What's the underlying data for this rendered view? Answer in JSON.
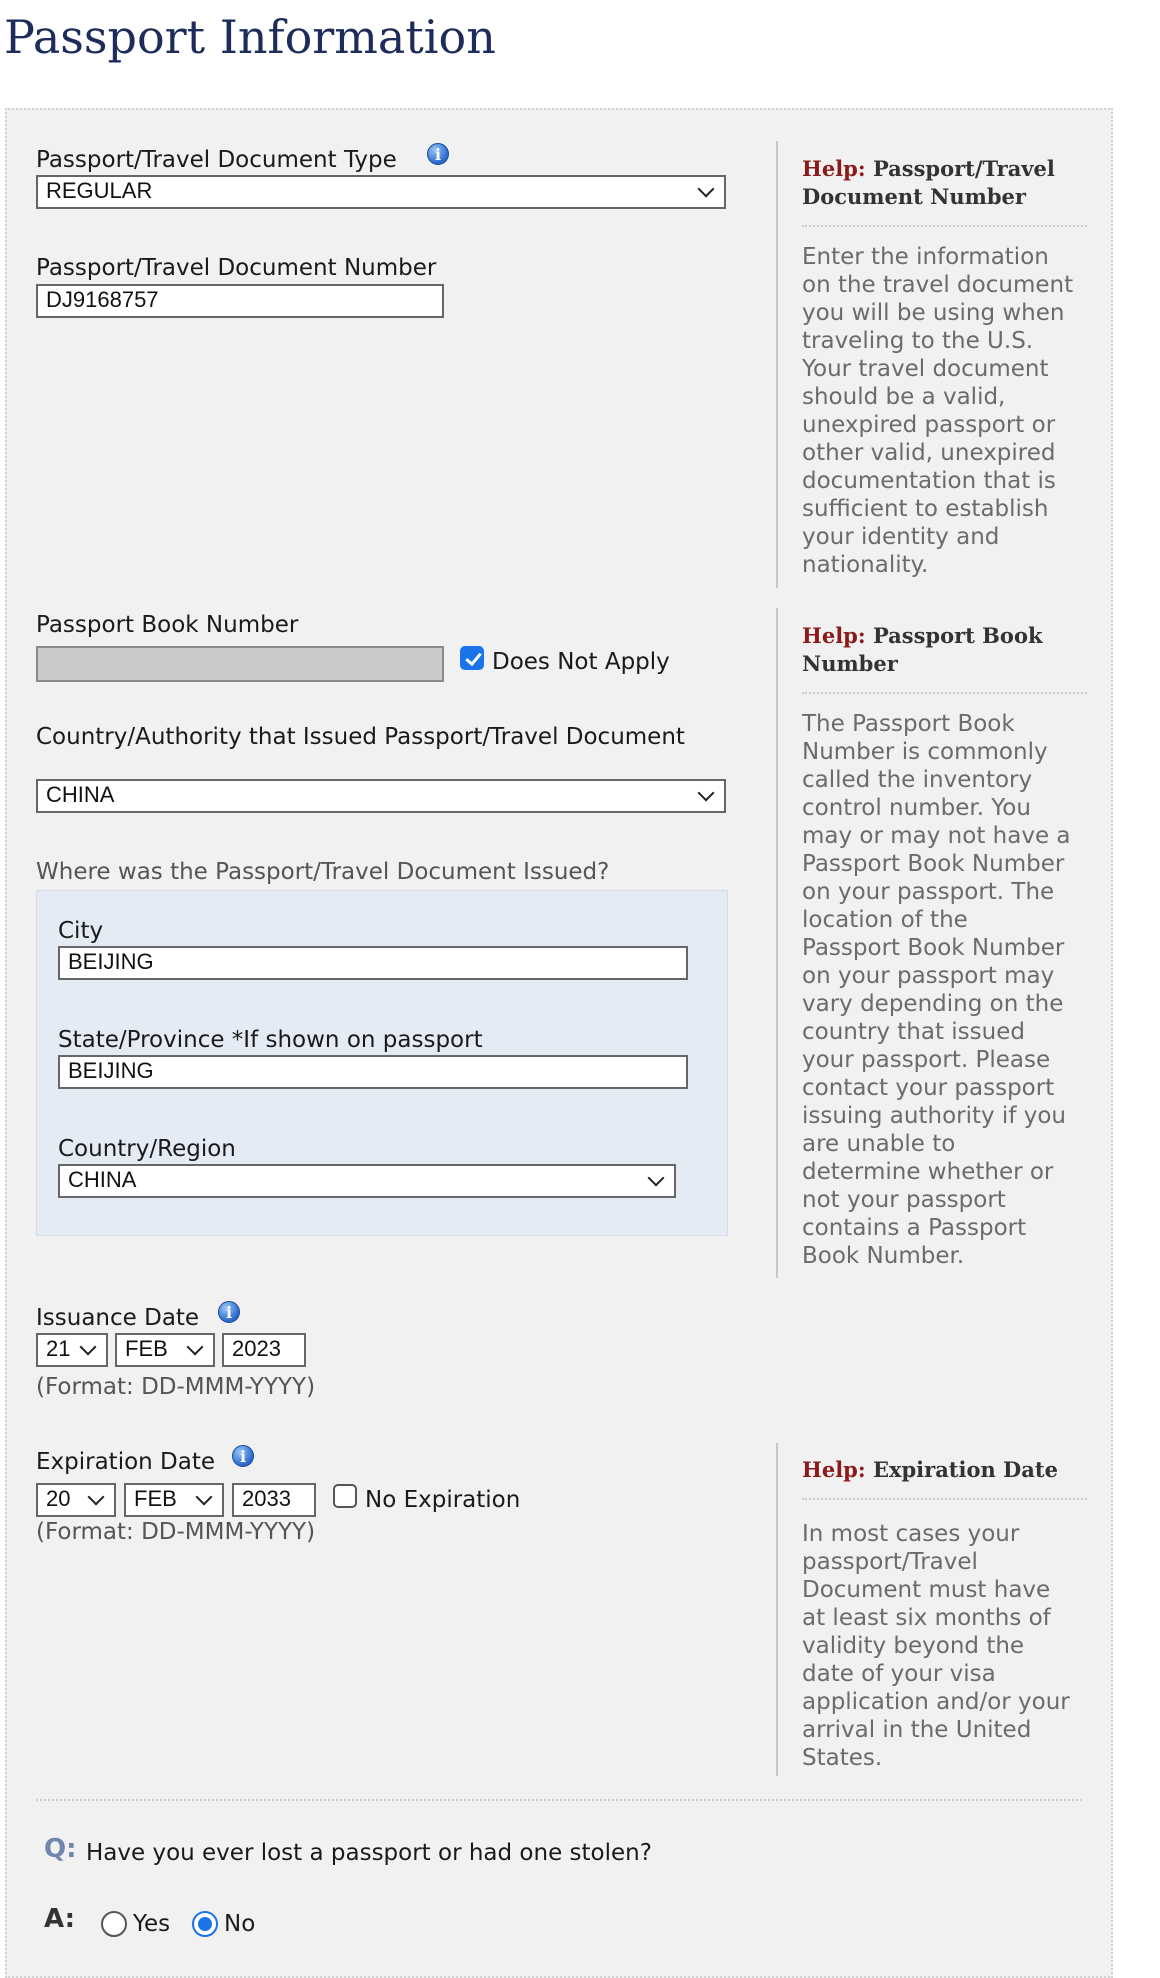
{
  "page_title": "Passport Information",
  "colors": {
    "title": "#1d2c5a",
    "help_word": "#8b1a1a",
    "accent": "#1a73e8",
    "issued_panel": "#e4ebf5"
  },
  "doc_type": {
    "label": "Passport/Travel Document Type",
    "value": "REGULAR",
    "info_icon": "info-icon"
  },
  "doc_number": {
    "label": "Passport/Travel Document Number",
    "value": "DJ9168757"
  },
  "book_number": {
    "label": "Passport Book Number",
    "value": "",
    "does_not_apply_label": "Does Not Apply",
    "does_not_apply_checked": true
  },
  "issuing_country": {
    "label": "Country/Authority that Issued Passport/Travel Document",
    "value": "CHINA"
  },
  "issued_where": {
    "label": "Where was the Passport/Travel Document Issued?",
    "city_label": "City",
    "city_value": "BEIJING",
    "state_label": "State/Province *If shown on passport",
    "state_value": "BEIJING",
    "country_label": "Country/Region",
    "country_value": "CHINA"
  },
  "issuance_date": {
    "label": "Issuance Date",
    "day": "21",
    "month": "FEB",
    "year": "2023",
    "format": "(Format: DD-MMM-YYYY)"
  },
  "expiration_date": {
    "label": "Expiration Date",
    "day": "20",
    "month": "FEB",
    "year": "2033",
    "no_expiration_label": "No Expiration",
    "no_expiration_checked": false,
    "format": "(Format: DD-MMM-YYYY)"
  },
  "help": [
    {
      "word": "Help:",
      "title": "Passport/Travel Document Number",
      "lines": [
        "Enter the information",
        "on the travel document",
        "you will be using when",
        "traveling to the U.S.",
        "Your travel document",
        "should be a valid,",
        "unexpired passport or",
        "other valid, unexpired",
        "documentation that is",
        "sufficient to establish",
        "your identity and",
        "nationality."
      ]
    },
    {
      "word": "Help:",
      "title": "Passport Book Number",
      "lines": [
        "The Passport Book",
        "Number is commonly",
        "called the inventory",
        "control number. You",
        "may or may not have a",
        "Passport Book Number",
        "on your passport. The",
        "location of the",
        "Passport Book Number",
        "on your passport may",
        "vary depending on the",
        "country that issued",
        "your passport. Please",
        "contact your passport",
        "issuing authority if you",
        "are unable to",
        "determine whether or",
        "not your passport",
        "contains a Passport",
        "Book Number."
      ]
    },
    {
      "word": "Help:",
      "title": "Expiration Date",
      "lines": [
        "In most cases your",
        "passport/Travel",
        "Document must have",
        "at least six months of",
        "validity beyond the",
        "date of your visa",
        "application and/or your",
        "arrival in the United",
        "States."
      ]
    }
  ],
  "lost_passport": {
    "q_letter": "Q:",
    "question": "Have you ever lost a passport or had one stolen?",
    "a_letter": "A:",
    "yes_label": "Yes",
    "no_label": "No",
    "selected": "No"
  }
}
